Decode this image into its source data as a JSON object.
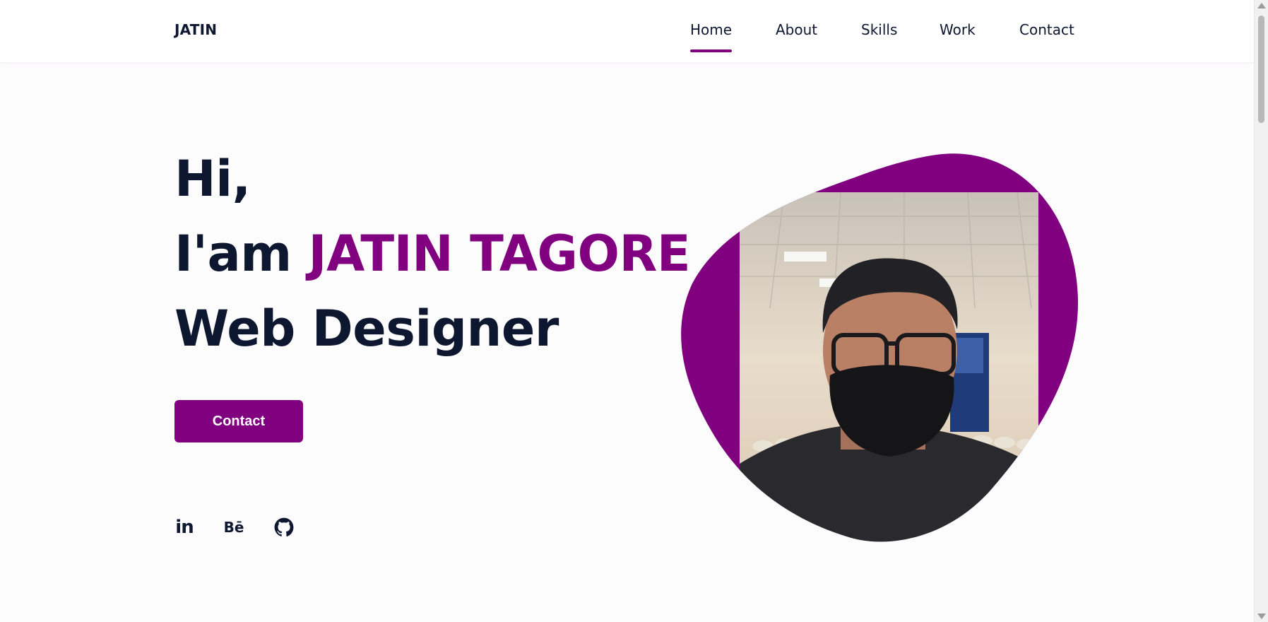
{
  "colors": {
    "accent": "#800080",
    "text": "#0e1730",
    "background": "#fdfcfd"
  },
  "header": {
    "logo": "JATIN",
    "nav": [
      {
        "label": "Home",
        "active": true
      },
      {
        "label": "About",
        "active": false
      },
      {
        "label": "Skills",
        "active": false
      },
      {
        "label": "Work",
        "active": false
      },
      {
        "label": "Contact",
        "active": false
      }
    ]
  },
  "hero": {
    "greeting": "Hi,",
    "intro_prefix": "I'am",
    "name": "JATIN TAGORE",
    "role": "Web Designer",
    "contact_button": "Contact",
    "socials": [
      {
        "icon": "linkedin-icon",
        "glyph": "in"
      },
      {
        "icon": "behance-icon",
        "glyph": "Bē"
      },
      {
        "icon": "github-icon"
      }
    ]
  },
  "profile_image": {
    "icon": "profile-photo"
  }
}
